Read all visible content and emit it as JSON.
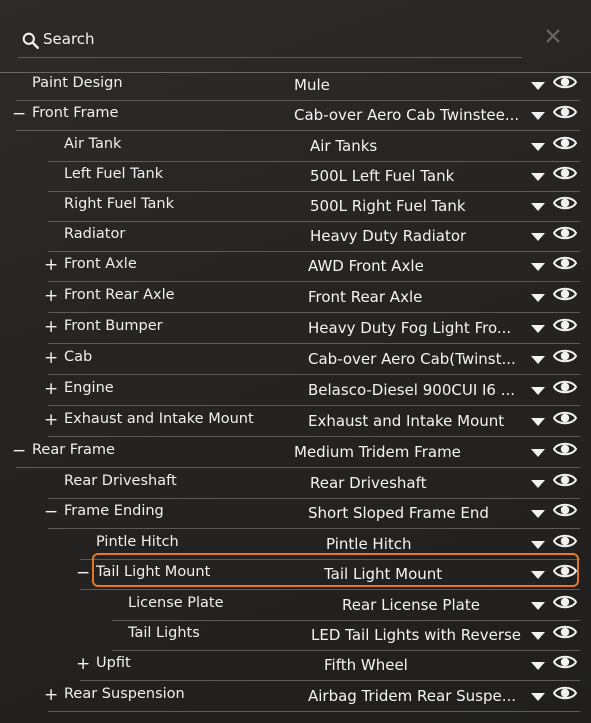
{
  "search": {
    "placeholder": "Search"
  },
  "rows": [
    {
      "label": "Paint Design",
      "value": "Mule",
      "expander": "",
      "level": 0
    },
    {
      "label": "Front Frame",
      "value": "Cab-over Aero Cab Twinstee...",
      "expander": "−",
      "level": 0
    },
    {
      "label": "Air Tank",
      "value": "Air Tanks",
      "expander": "",
      "level": 1
    },
    {
      "label": "Left Fuel Tank",
      "value": "500L Left Fuel Tank",
      "expander": "",
      "level": 1
    },
    {
      "label": "Right Fuel Tank",
      "value": "500L Right Fuel Tank",
      "expander": "",
      "level": 1
    },
    {
      "label": "Radiator",
      "value": "Heavy Duty Radiator",
      "expander": "",
      "level": 1
    },
    {
      "label": "Front Axle",
      "value": "AWD Front Axle",
      "expander": "+",
      "level": 1
    },
    {
      "label": "Front Rear Axle",
      "value": "Front Rear Axle",
      "expander": "+",
      "level": 1
    },
    {
      "label": "Front Bumper",
      "value": "Heavy Duty Fog Light Fro...",
      "expander": "+",
      "level": 1
    },
    {
      "label": "Cab",
      "value": "Cab-over Aero Cab(Twinst...",
      "expander": "+",
      "level": 1
    },
    {
      "label": "Engine",
      "value": "Belasco-Diesel 900CUI I6 ...",
      "expander": "+",
      "level": 1
    },
    {
      "label": "Exhaust and Intake Mount",
      "value": "Exhaust and Intake Mount",
      "expander": "+",
      "level": 1
    },
    {
      "label": "Rear Frame",
      "value": "Medium Tridem Frame",
      "expander": "−",
      "level": 0
    },
    {
      "label": "Rear Driveshaft",
      "value": "Rear Driveshaft",
      "expander": "",
      "level": 1
    },
    {
      "label": "Frame Ending",
      "value": "Short Sloped Frame End",
      "expander": "−",
      "level": 1
    },
    {
      "label": "Pintle Hitch",
      "value": "Pintle Hitch",
      "expander": "",
      "level": 2
    },
    {
      "label": "Tail Light Mount",
      "value": "Tail Light Mount",
      "expander": "−",
      "level": 2,
      "selected": true
    },
    {
      "label": "License Plate",
      "value": "Rear License Plate",
      "expander": "",
      "level": 3
    },
    {
      "label": "Tail Lights",
      "value": "LED Tail Lights with Reverse",
      "expander": "",
      "level": 3
    },
    {
      "label": "Upfit",
      "value": "Fifth Wheel",
      "expander": "+",
      "level": 2
    },
    {
      "label": "Rear Suspension",
      "value": "Airbag Tridem Rear Suspe...",
      "expander": "+",
      "level": 1
    }
  ],
  "colors": {
    "background": "#262422",
    "separator": "#5d5a57",
    "highlight": "#e07a24",
    "text": "#f0f0f0"
  },
  "icons": {
    "search": "magnifier-icon",
    "close": "close-icon",
    "dropdown": "caret-down-icon",
    "visibility": "eye-icon"
  }
}
